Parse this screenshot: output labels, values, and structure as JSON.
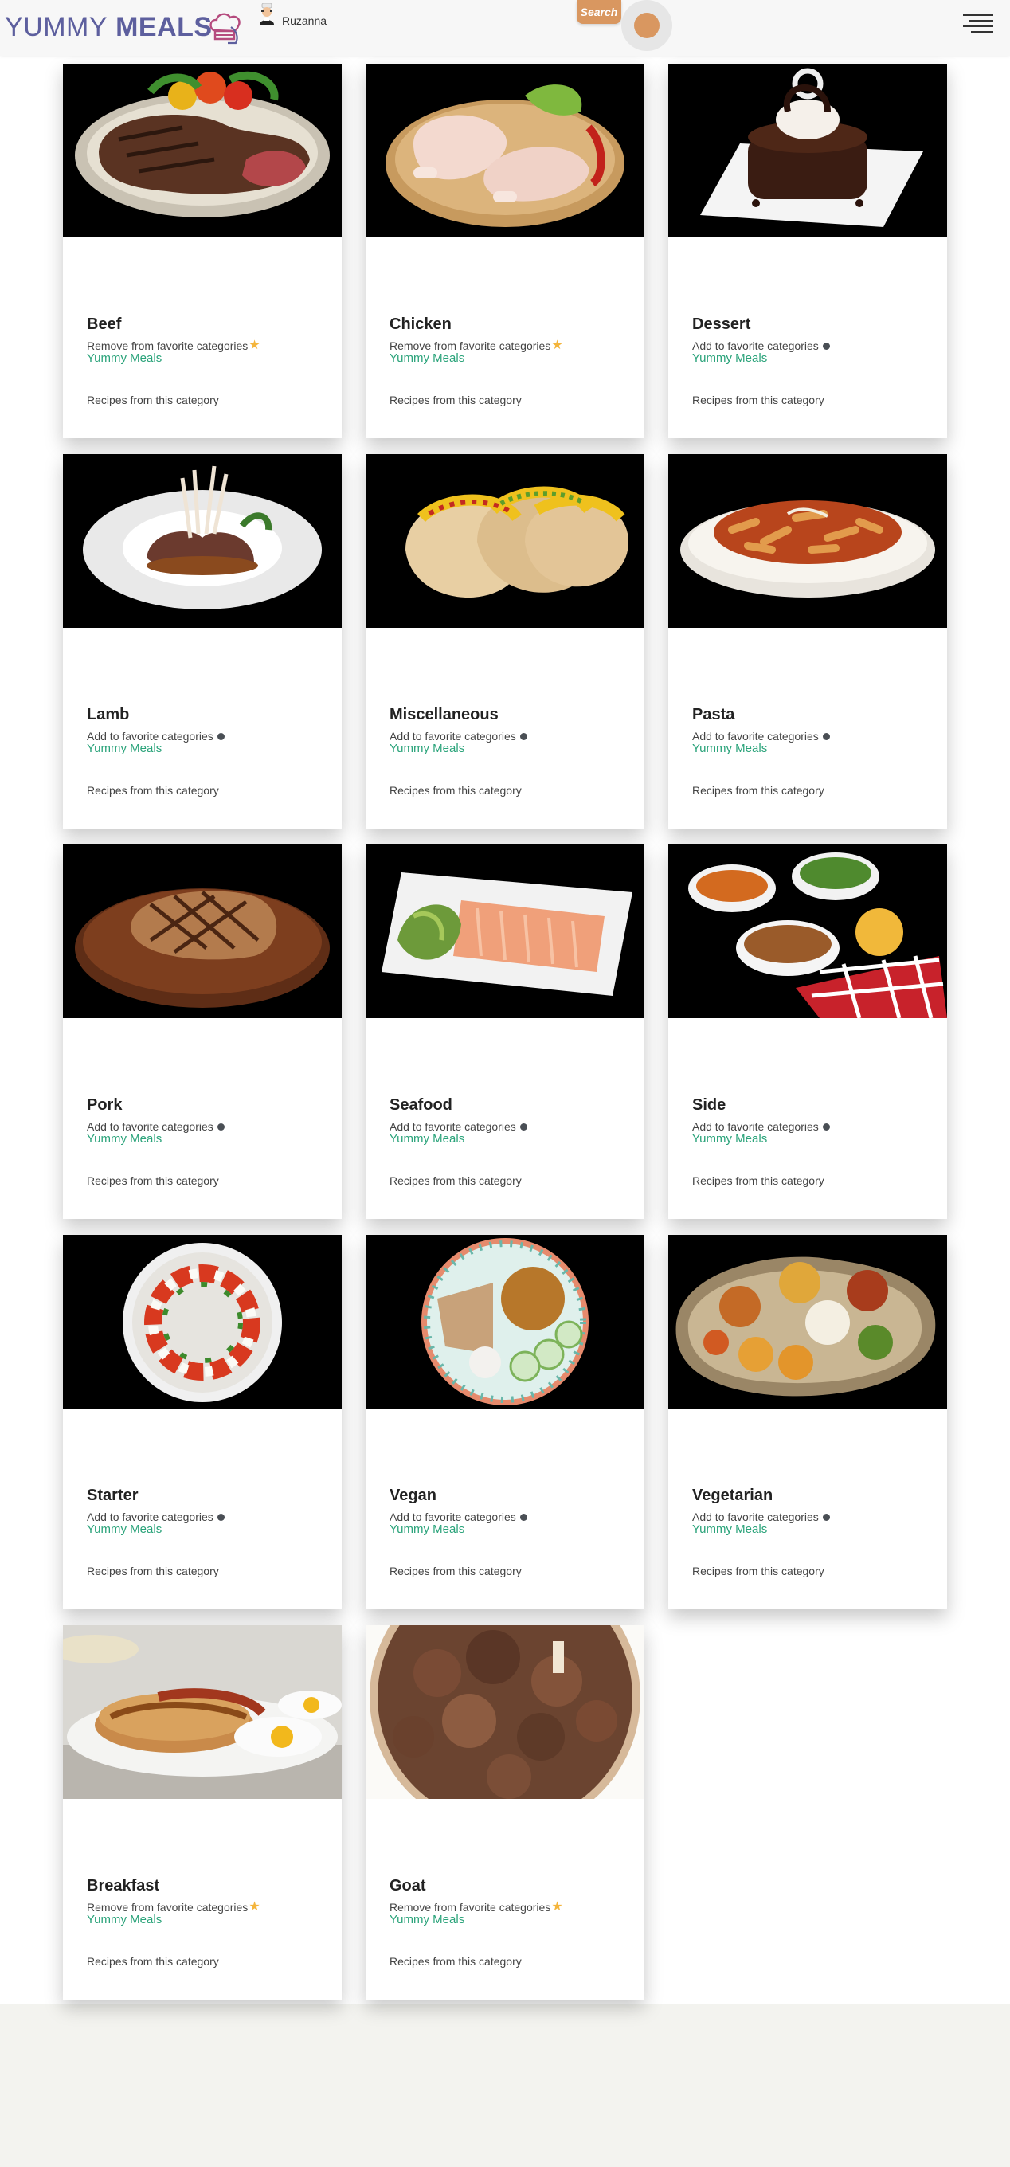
{
  "header": {
    "brand_word1": "YUMMY",
    "brand_word2": "MEALS",
    "user_name": "Ruzanna",
    "search_label": "Search"
  },
  "cards": [
    {
      "title": "Beef",
      "fav_label": "Remove from favorite categories",
      "favorite": true,
      "site": "Yummy Meals",
      "link": "Recipes from this category",
      "image": "steak-plate"
    },
    {
      "title": "Chicken",
      "fav_label": "Remove from favorite categories",
      "favorite": true,
      "site": "Yummy Meals",
      "link": "Recipes from this category",
      "image": "raw-chicken"
    },
    {
      "title": "Dessert",
      "fav_label": "Add to favorite categories",
      "favorite": false,
      "site": "Yummy Meals",
      "link": "Recipes from this category",
      "image": "chocolate-cake"
    },
    {
      "title": "Lamb",
      "fav_label": "Add to favorite categories",
      "favorite": false,
      "site": "Yummy Meals",
      "link": "Recipes from this category",
      "image": "lamb-chops"
    },
    {
      "title": "Miscellaneous",
      "fav_label": "Add to favorite categories",
      "favorite": false,
      "site": "Yummy Meals",
      "link": "Recipes from this category",
      "image": "tacos"
    },
    {
      "title": "Pasta",
      "fav_label": "Add to favorite categories",
      "favorite": false,
      "site": "Yummy Meals",
      "link": "Recipes from this category",
      "image": "penne-pasta"
    },
    {
      "title": "Pork",
      "fav_label": "Add to favorite categories",
      "favorite": false,
      "site": "Yummy Meals",
      "link": "Recipes from this category",
      "image": "pork-chop"
    },
    {
      "title": "Seafood",
      "fav_label": "Add to favorite categories",
      "favorite": false,
      "site": "Yummy Meals",
      "link": "Recipes from this category",
      "image": "salmon-plate"
    },
    {
      "title": "Side",
      "fav_label": "Add to favorite categories",
      "favorite": false,
      "site": "Yummy Meals",
      "link": "Recipes from this category",
      "image": "side-bowls"
    },
    {
      "title": "Starter",
      "fav_label": "Add to favorite categories",
      "favorite": false,
      "site": "Yummy Meals",
      "link": "Recipes from this category",
      "image": "caprese"
    },
    {
      "title": "Vegan",
      "fav_label": "Add to favorite categories",
      "favorite": false,
      "site": "Yummy Meals",
      "link": "Recipes from this category",
      "image": "vegan-bowl"
    },
    {
      "title": "Vegetarian",
      "fav_label": "Add to favorite categories",
      "favorite": false,
      "site": "Yummy Meals",
      "link": "Recipes from this category",
      "image": "thali"
    },
    {
      "title": "Breakfast",
      "fav_label": "Remove from favorite categories",
      "favorite": true,
      "site": "Yummy Meals",
      "link": "Recipes from this category",
      "image": "pancakes"
    },
    {
      "title": "Goat",
      "fav_label": "Remove from favorite categories",
      "favorite": true,
      "site": "Yummy Meals",
      "link": "Recipes from this category",
      "image": "goat-stew"
    }
  ],
  "colors": {
    "brand": "#5d5f9e",
    "accent": "#d99760",
    "link_green": "#2aa37a",
    "star": "#f4b53c"
  }
}
